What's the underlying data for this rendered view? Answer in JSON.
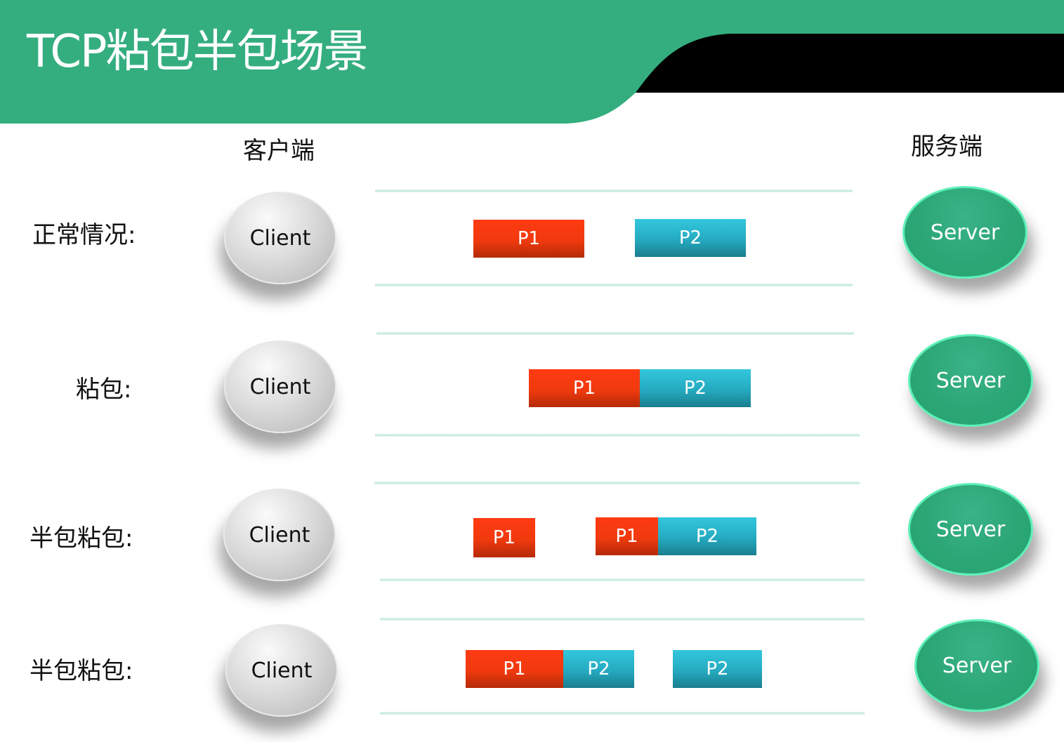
{
  "title": "TCP粘包半包场景",
  "headers": {
    "client": "客户端",
    "server": "服务端"
  },
  "scenarios": [
    {
      "label": "正常情况:",
      "client": "Client",
      "server": "Server",
      "packets": [
        {
          "label": "P1",
          "kind": "p1"
        },
        {
          "label": "P2",
          "kind": "p2"
        }
      ]
    },
    {
      "label": "粘包:",
      "client": "Client",
      "server": "Server",
      "packets": [
        {
          "label": "P1",
          "kind": "p1"
        },
        {
          "label": "P2",
          "kind": "p2"
        }
      ]
    },
    {
      "label": "半包粘包:",
      "client": "Client",
      "server": "Server",
      "packets": [
        {
          "label": "P1",
          "kind": "p1"
        },
        {
          "label": "P1",
          "kind": "p1"
        },
        {
          "label": "P2",
          "kind": "p2"
        }
      ]
    },
    {
      "label": "半包粘包:",
      "client": "Client",
      "server": "Server",
      "packets": [
        {
          "label": "P1",
          "kind": "p1"
        },
        {
          "label": "P2",
          "kind": "p2"
        },
        {
          "label": "P2",
          "kind": "p2"
        }
      ]
    }
  ],
  "colors": {
    "banner": "#34ae7f",
    "packet_p1": "#f03a0e",
    "packet_p2": "#25aac0",
    "server": "#2da676"
  }
}
